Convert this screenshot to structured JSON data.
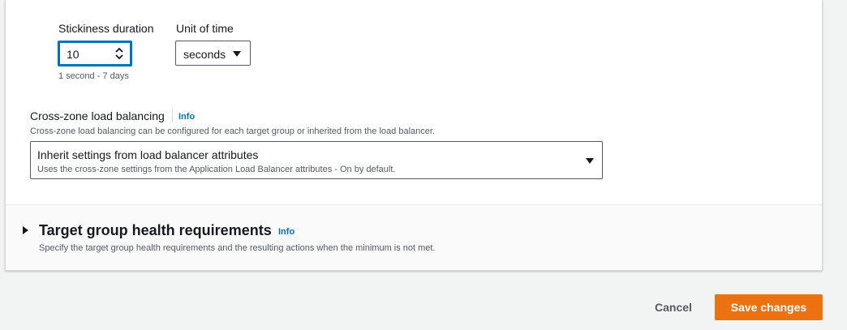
{
  "stickiness": {
    "duration_label": "Stickiness duration",
    "duration_value": "10",
    "duration_hint": "1 second - 7 days",
    "unit_label": "Unit of time",
    "unit_value": "seconds"
  },
  "cross_zone": {
    "label": "Cross-zone load balancing",
    "info": "Info",
    "description": "Cross-zone load balancing can be configured for each target group or inherited from the load balancer.",
    "selected_title": "Inherit settings from load balancer attributes",
    "selected_description": "Uses the cross-zone settings from the Application Load Balancer attributes - On by default."
  },
  "health_section": {
    "title": "Target group health requirements",
    "info": "Info",
    "description": "Specify the target group health requirements and the resulting actions when the minimum is not met.",
    "expanded": false
  },
  "footer": {
    "cancel_label": "Cancel",
    "save_label": "Save changes"
  },
  "colors": {
    "primary_button": "#ec7211",
    "focus_border": "#0073bb",
    "link": "#0073bb"
  }
}
